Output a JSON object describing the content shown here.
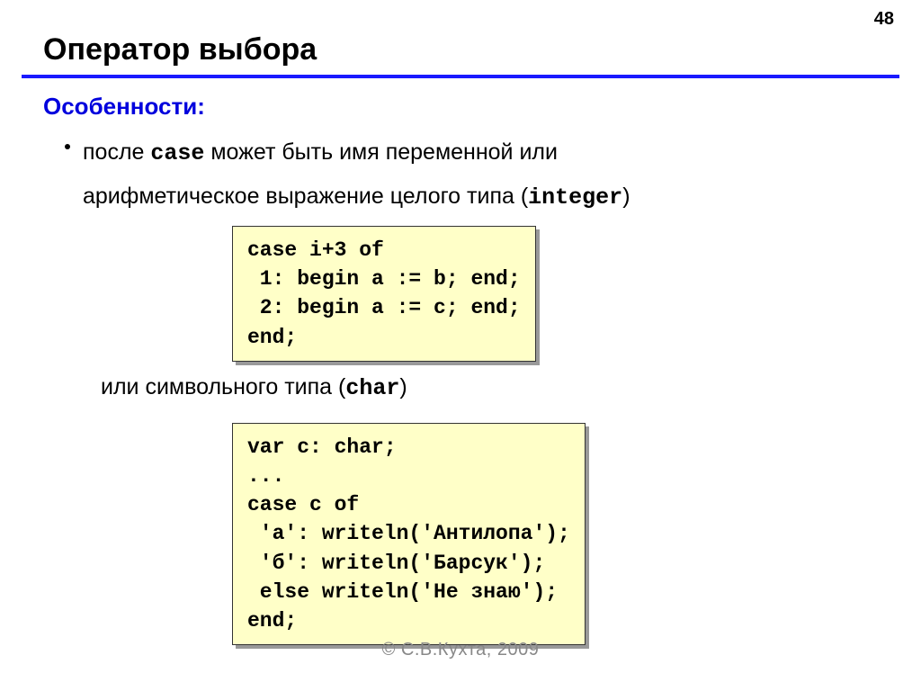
{
  "pageNumber": "48",
  "title": "Оператор выбора",
  "subtitle": "Особенности:",
  "bullet": {
    "line1_pre": "после ",
    "line1_code": "case",
    "line1_post": " может быть имя переменной или",
    "line2_pre": "арифметическое выражение целого типа (",
    "line2_code": "integer",
    "line2_post": ")"
  },
  "code1": "case i+3 of\n 1: begin a := b; end;\n 2: begin a := c; end;\nend;",
  "midtext_pre": "или символьного типа (",
  "midtext_code": "char",
  "midtext_post": ")",
  "code2": "var c: char;\n...\ncase c of\n 'а': writeln('Антилопа');\n 'б': writeln('Барсук');\n else writeln('Не знаю');\nend;",
  "footer": "© С.В.Кухта, 2009"
}
